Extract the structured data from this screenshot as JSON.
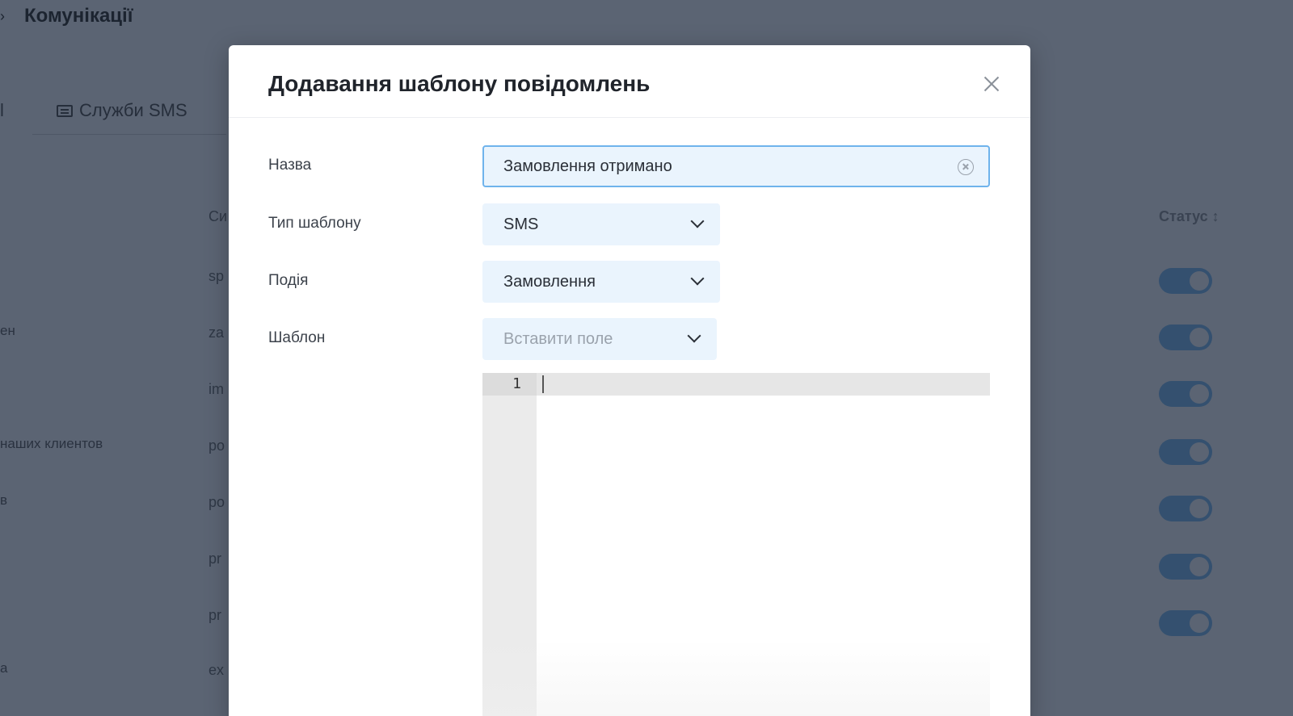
{
  "background": {
    "page_title": "Комунікації",
    "tab_fragment": "l",
    "tab_sms": "Служби SMS",
    "column_fragment": "Си",
    "status_header": "Статус ↕",
    "left_texts": [
      "ен",
      "наших клиентов",
      "в",
      "а"
    ],
    "code_fragments": [
      "sp",
      "za",
      "im",
      "po",
      "po",
      "pr",
      "pr",
      "ex"
    ],
    "toggles_on": 7
  },
  "modal": {
    "title": "Додавання шаблону повідомлень",
    "fields": {
      "name_label": "Назва",
      "name_value": "Замовлення отримано",
      "type_label": "Тип шаблону",
      "type_value": "SMS",
      "event_label": "Подія",
      "event_value": "Замовлення",
      "template_label": "Шаблон",
      "insert_field_placeholder": "Вставити поле"
    },
    "editor": {
      "line_number": "1"
    }
  },
  "icons": {
    "close": "close-icon",
    "clear": "clear-icon",
    "chevron": "chevron-down-icon",
    "sms": "sms-icon"
  },
  "colors": {
    "accent_border": "#6fb3ec",
    "input_bg": "#eaf4fd",
    "toggle_on": "#34506f"
  }
}
